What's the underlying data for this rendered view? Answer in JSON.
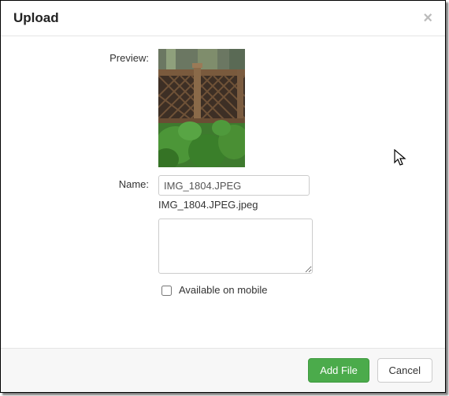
{
  "header": {
    "title": "Upload"
  },
  "form": {
    "preview_label": "Preview:",
    "name_label": "Name:",
    "name_value": "IMG_1804.JPEG",
    "filename_display": "IMG_1804.JPEG.jpeg",
    "available_mobile_label": "Available on mobile"
  },
  "footer": {
    "add_file_label": "Add File",
    "cancel_label": "Cancel"
  }
}
